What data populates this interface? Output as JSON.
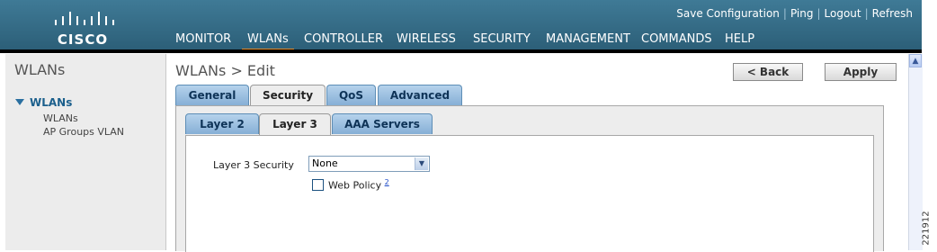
{
  "brand": {
    "name": "CISCO",
    "logo": "cisco-bridge-logo"
  },
  "utility_links": [
    "Save Configuration",
    "Ping",
    "Logout",
    "Refresh"
  ],
  "main_nav": [
    {
      "label": "MONITOR",
      "active": false
    },
    {
      "label": "WLANs",
      "active": true
    },
    {
      "label": "CONTROLLER",
      "active": false
    },
    {
      "label": "WIRELESS",
      "active": false
    },
    {
      "label": "SECURITY",
      "active": false
    },
    {
      "label": "MANAGEMENT",
      "active": false
    },
    {
      "label": "COMMANDS",
      "active": false
    },
    {
      "label": "HELP",
      "active": false
    }
  ],
  "sidebar": {
    "title": "WLANs",
    "group": "WLANs",
    "items": [
      "WLANs",
      "AP Groups VLAN"
    ]
  },
  "page": {
    "title": "WLANs > Edit",
    "back_label": "< Back",
    "apply_label": "Apply"
  },
  "tabs": [
    {
      "label": "General",
      "active": false
    },
    {
      "label": "Security",
      "active": true
    },
    {
      "label": "QoS",
      "active": false
    },
    {
      "label": "Advanced",
      "active": false
    }
  ],
  "subtabs": [
    {
      "label": "Layer 2",
      "active": false
    },
    {
      "label": "Layer 3",
      "active": true
    },
    {
      "label": "AAA Servers",
      "active": false
    }
  ],
  "layer3": {
    "security_label": "Layer 3 Security",
    "security_value": "None",
    "web_policy_label": "Web Policy",
    "web_policy_note": "2",
    "web_policy_checked": false
  },
  "figure_number": "221912",
  "colors": {
    "header": "#2f6680",
    "active_nav_underline": "#e98c2a",
    "tab_blue": "#9bc0e3",
    "sidebar_link": "#1b5f8c"
  }
}
